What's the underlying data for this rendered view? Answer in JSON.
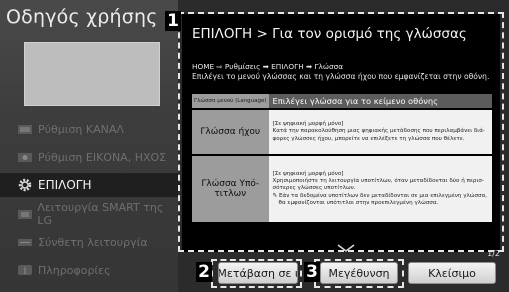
{
  "left_panel": {
    "title": "Οδηγός χρήσης",
    "items": [
      {
        "label": "Ρύθμιση ΚΑΝΑΛ",
        "icon": "antenna-icon",
        "active": false
      },
      {
        "label": "Ρύθμιση ΕΙΚΟΝΑ, ΗΧΟΣ",
        "icon": "picture-sound-icon",
        "active": false
      },
      {
        "label": "ΕΠΙΛΟΓΗ",
        "icon": "gear-icon",
        "active": true
      },
      {
        "label": "Λειτουργία SMART της LG",
        "icon": "smart-tv-icon",
        "active": false
      },
      {
        "label": "Σύνθετη λειτουργία",
        "icon": "advanced-icon",
        "active": false
      },
      {
        "label": "Πληροφορίες",
        "icon": "info-icon",
        "active": false
      }
    ]
  },
  "main": {
    "title": "ΕΠΙΛΟΓΗ > Για τον ορισμό της γλώσσας",
    "path_line": "HOME ⇨ Ρυθμίσεις ➡ ΕΠΙΛΟΓΗ ➡ Γλώσσα",
    "description": "Επιλέγει το μενού γλώσσας και τη γλώσσα ήχου που εμφανίζεται στην οθόνη.",
    "table_header": {
      "left": "Γλώσσα μενού (Language)",
      "right": "Επιλέγει γλώσσα για το κείμενο οθόνης"
    },
    "rows": [
      {
        "label": "Γλώσσα ήχου",
        "lines": [
          "[Σε ψηφιακή μορφή μόνο]",
          "Κατά την παρακολούθηση μιας ψηφιακής μετάδοσης που περιλαμβάνει διά-",
          "φορες γλώσσες ήχου, μπορείτε να επιλέξετε τη γλώσσα που θέλετε."
        ]
      },
      {
        "label": "Γλώσσα Υπότιτλων",
        "label_line1": "Γλώσσα Υπό-",
        "label_line2": "τιτλων",
        "lines": [
          "[Σε ψηφιακή μορφή μόνο]",
          "Χρησιμοποιήστε τη λειτουργία υποτίτλων, όταν μεταδίδονται δύο ή περισ-",
          "σότερες γλώσσες υποτίτλων.",
          "✎ Εάν τα δεδομένα υποτίτλων δεν μεταδίδονται σε μια επιλεγμένη γλώσσα,",
          "θα εμφανίζονται υπότιτλοι στην προεπιλεγμένη γλώσσα."
        ]
      }
    ],
    "pager": "1/2"
  },
  "badges": {
    "one": "1",
    "two": "2",
    "three": "3"
  },
  "buttons": {
    "goto": "Μετάβαση σε ι",
    "zoom": "Μεγέθυνση",
    "close": "Κλείσιμο"
  }
}
